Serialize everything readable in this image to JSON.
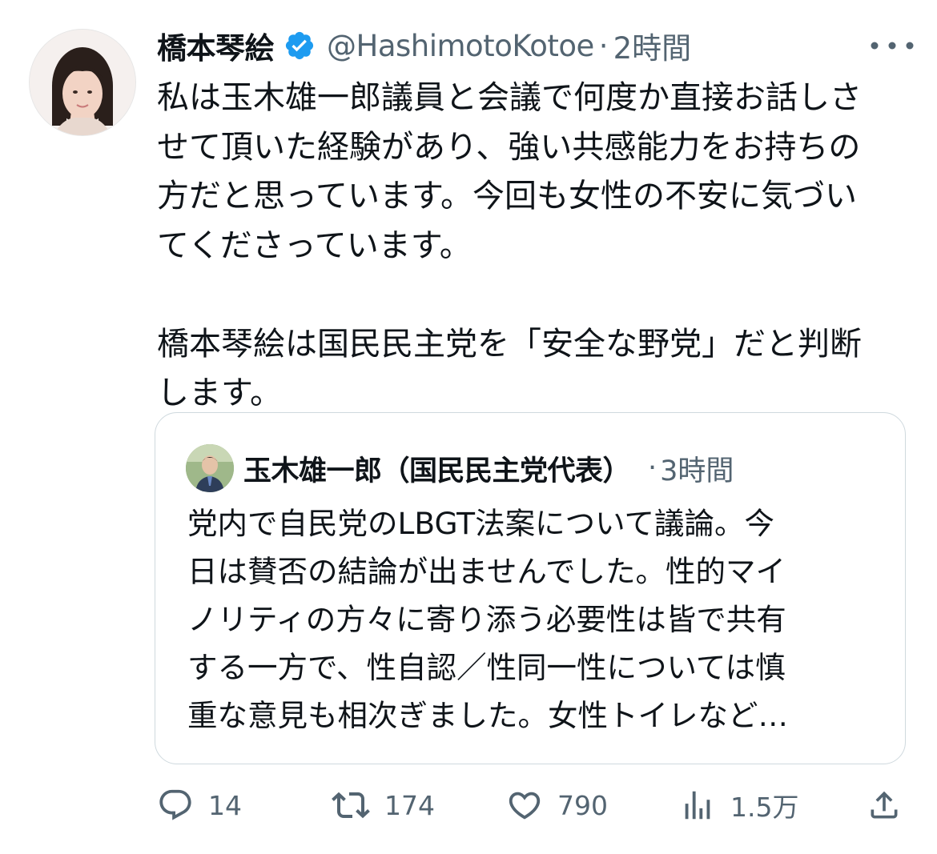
{
  "author": {
    "display_name": "橋本琴絵",
    "handle": "@HashimotoKotoe",
    "separator": "·",
    "time": "2時間",
    "verified": true
  },
  "post": {
    "text": "私は玉木雄一郎議員と会議で何度か直接お話しさ\nせて頂いた経験があり、強い共感能力をお持ちの\n方だと思っています。今回も女性の不安に気づい\nてくださっています。\n\n橋本琴絵は国民民主党を「安全な野党」だと判断\nします。"
  },
  "quote": {
    "display_name": "玉木雄一郎（国民民主党代表）",
    "separator": "·",
    "time": "3時間",
    "text": "党内で自民党のLBGT法案について議論。今\n日は賛否の結論が出ませんでした。性的マイ\nノリティの方々に寄り添う必要性は皆で共有\nする一方で、性自認／性同一性については慎\n重な意見も相次ぎました。女性トイレなど…"
  },
  "actions": {
    "reply_count": "14",
    "repost_count": "174",
    "like_count": "790",
    "views_count": "1.5万"
  },
  "colors": {
    "text": "#0f1419",
    "secondary": "#536471",
    "verified": "#1d9bf0",
    "border": "#cfd9de"
  },
  "icons": {
    "verified": "verified-badge-icon",
    "more": "more-dots-icon",
    "reply": "reply-bubble-icon",
    "repost": "repost-arrows-icon",
    "like": "heart-icon",
    "views": "views-bars-icon",
    "share": "share-upload-icon"
  }
}
